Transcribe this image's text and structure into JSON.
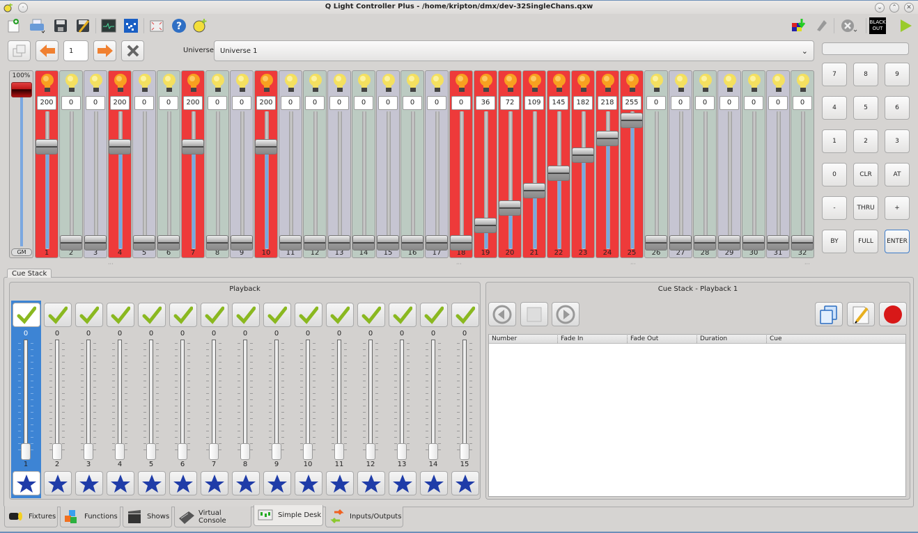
{
  "window": {
    "title": "Q Light Controller Plus - /home/kripton/dmx/dev-32SingleChans.qxw"
  },
  "toolbar": {
    "left_icons": [
      "new-workspace-icon",
      "open-icon",
      "save-icon",
      "save-as-icon",
      "monitor-icon",
      "address-tool-icon",
      "fullscreen-icon",
      "help-icon",
      "about-icon"
    ],
    "right_icons": [
      "fixture-remap-icon",
      "disable-io-icon",
      "stop-all-functions-icon",
      "blackout-icon",
      "operate-mode-icon"
    ],
    "blackout_label_1": "BLACK",
    "blackout_label_2": "OUT"
  },
  "desk": {
    "page_value": "1",
    "universe_label": "Universe",
    "universe_selected": "Universe 1",
    "keypad_input": "",
    "gm_percent": "100%",
    "gm_label": "GM",
    "gm_level": 1.0,
    "channels": [
      {
        "n": "1",
        "v": 200,
        "on": true
      },
      {
        "n": "2",
        "v": 0,
        "on": false
      },
      {
        "n": "3",
        "v": 0,
        "on": false
      },
      {
        "n": "4",
        "v": 200,
        "on": true
      },
      {
        "n": "5",
        "v": 0,
        "on": false
      },
      {
        "n": "6",
        "v": 0,
        "on": false
      },
      {
        "n": "7",
        "v": 200,
        "on": true
      },
      {
        "n": "8",
        "v": 0,
        "on": false
      },
      {
        "n": "9",
        "v": 0,
        "on": false
      },
      {
        "n": "10",
        "v": 200,
        "on": true
      },
      {
        "n": "11",
        "v": 0,
        "on": false
      },
      {
        "n": "12",
        "v": 0,
        "on": false
      },
      {
        "n": "13",
        "v": 0,
        "on": false
      },
      {
        "n": "14",
        "v": 0,
        "on": false
      },
      {
        "n": "15",
        "v": 0,
        "on": false
      },
      {
        "n": "16",
        "v": 0,
        "on": false
      },
      {
        "n": "17",
        "v": 0,
        "on": false
      },
      {
        "n": "18",
        "v": 0,
        "on": true
      },
      {
        "n": "19",
        "v": 36,
        "on": true
      },
      {
        "n": "20",
        "v": 72,
        "on": true
      },
      {
        "n": "21",
        "v": 109,
        "on": true
      },
      {
        "n": "22",
        "v": 145,
        "on": true
      },
      {
        "n": "23",
        "v": 182,
        "on": true
      },
      {
        "n": "24",
        "v": 218,
        "on": true
      },
      {
        "n": "25",
        "v": 255,
        "on": true
      },
      {
        "n": "26",
        "v": 0,
        "on": false
      },
      {
        "n": "27",
        "v": 0,
        "on": false
      },
      {
        "n": "28",
        "v": 0,
        "on": false
      },
      {
        "n": "29",
        "v": 0,
        "on": false
      },
      {
        "n": "30",
        "v": 0,
        "on": false
      },
      {
        "n": "31",
        "v": 0,
        "on": false
      },
      {
        "n": "32",
        "v": 0,
        "on": false
      }
    ],
    "keypad": [
      "7",
      "8",
      "9",
      "4",
      "5",
      "6",
      "1",
      "2",
      "3",
      "0",
      "CLR",
      "AT",
      "-",
      "THRU",
      "+",
      "BY",
      "FULL",
      "ENTER"
    ],
    "colors": {
      "active": "#ee3a3a",
      "even": "#bccbc2",
      "odd": "#c6c5d2",
      "fill": "#7aa7e0"
    }
  },
  "cuestack": {
    "tab_label": "Cue Stack",
    "playback_title": "Playback",
    "playbacks": [
      {
        "n": "1",
        "v": "0",
        "selected": true
      },
      {
        "n": "2",
        "v": "0"
      },
      {
        "n": "3",
        "v": "0"
      },
      {
        "n": "4",
        "v": "0"
      },
      {
        "n": "5",
        "v": "0"
      },
      {
        "n": "6",
        "v": "0"
      },
      {
        "n": "7",
        "v": "0"
      },
      {
        "n": "8",
        "v": "0"
      },
      {
        "n": "9",
        "v": "0"
      },
      {
        "n": "10",
        "v": "0"
      },
      {
        "n": "11",
        "v": "0"
      },
      {
        "n": "12",
        "v": "0"
      },
      {
        "n": "13",
        "v": "0"
      },
      {
        "n": "14",
        "v": "0"
      },
      {
        "n": "15",
        "v": "0"
      }
    ],
    "stack_title": "Cue Stack - Playback 1",
    "columns": [
      "Number",
      "Fade In",
      "Fade Out",
      "Duration",
      "Cue"
    ],
    "rows": []
  },
  "bottom_tabs": [
    {
      "label": "Fixtures",
      "icon": "fixtures-icon"
    },
    {
      "label": "Functions",
      "icon": "functions-icon"
    },
    {
      "label": "Shows",
      "icon": "shows-icon"
    },
    {
      "label": "Virtual Console",
      "icon": "virtual-console-icon"
    },
    {
      "label": "Simple Desk",
      "icon": "simple-desk-icon",
      "selected": true
    },
    {
      "label": "Inputs/Outputs",
      "icon": "inputs-outputs-icon"
    }
  ]
}
